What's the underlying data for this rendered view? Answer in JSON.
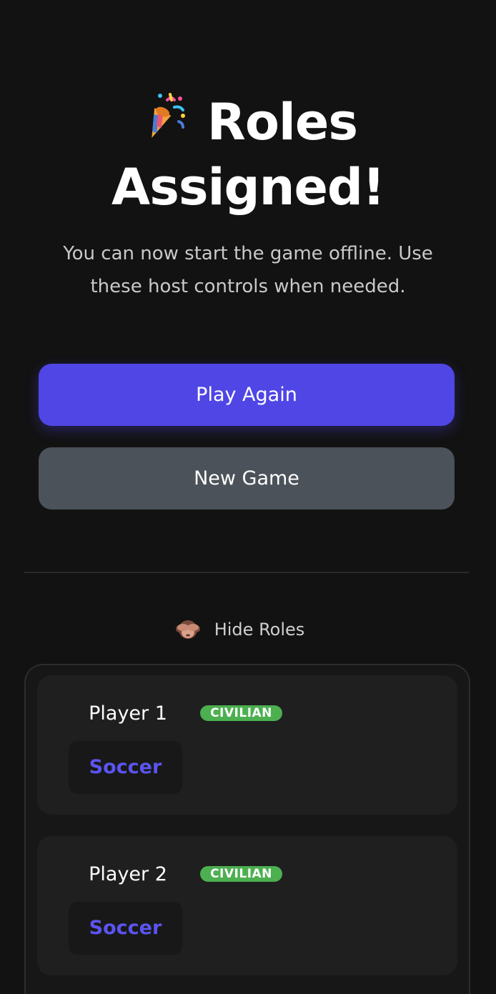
{
  "header": {
    "title_line1": "Roles",
    "title_line2": "Assigned!",
    "subtitle_line1": "You can now start the game offline. Use",
    "subtitle_line2": "these host controls when needed."
  },
  "actions": {
    "play_again_label": "Play Again",
    "new_game_label": "New Game"
  },
  "roles_toggle": {
    "label": "Hide Roles"
  },
  "players": [
    {
      "name": "Player 1",
      "role": "CIVILIAN",
      "word": "Soccer"
    },
    {
      "name": "Player 2",
      "role": "CIVILIAN",
      "word": "Soccer"
    }
  ],
  "colors": {
    "background": "#121212",
    "primary_button": "#4f46e5",
    "secondary_button": "#4b5259",
    "civilian_badge": "#4caf50",
    "word_text": "#5b54f0"
  },
  "icons": {
    "title_icon": "party-popper-icon",
    "hide_roles_icon": "see-no-evil-monkey-icon"
  }
}
